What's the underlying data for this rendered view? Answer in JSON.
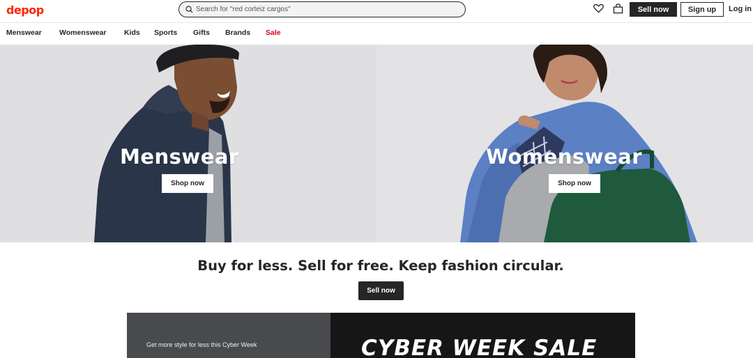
{
  "brand": {
    "logo": "depop",
    "color": "#ff2300"
  },
  "search": {
    "value": "Search for \"red corteiz cargos\""
  },
  "header": {
    "sell_label": "Sell now",
    "signup_label": "Sign up",
    "login_label": "Log in",
    "icons": [
      "heart-icon",
      "bag-icon"
    ]
  },
  "categories": [
    {
      "label": "Menswear"
    },
    {
      "label": "Womenswear"
    },
    {
      "label": "Kids"
    },
    {
      "label": "Sports"
    },
    {
      "label": "Gifts"
    },
    {
      "label": "Brands"
    },
    {
      "label": "Sale",
      "color": "#d9001b"
    }
  ],
  "hero": {
    "left": {
      "title": "Menswear",
      "button": "Shop now"
    },
    "right": {
      "title": "Womenswear",
      "button": "Shop now"
    }
  },
  "tagline": {
    "text": "Buy for less. Sell for free. Keep fashion circular.",
    "button": "Sell now"
  },
  "promo": {
    "text": "Get more style for less this Cyber Week",
    "title": "CYBER WEEK SALE"
  }
}
